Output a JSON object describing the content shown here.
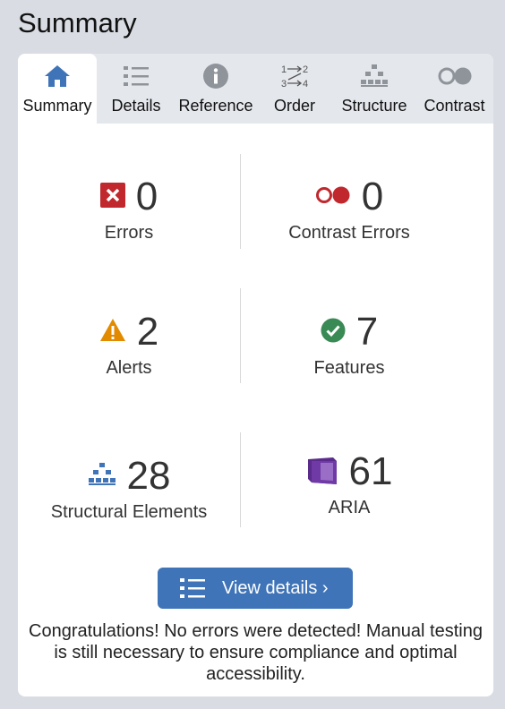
{
  "page_title": "Summary",
  "tabs": [
    {
      "label": "Summary",
      "icon": "home-icon",
      "active": true
    },
    {
      "label": "Details",
      "icon": "list-icon",
      "active": false
    },
    {
      "label": "Reference",
      "icon": "info-icon",
      "active": false
    },
    {
      "label": "Order",
      "icon": "order-icon",
      "active": false
    },
    {
      "label": "Structure",
      "icon": "structure-icon",
      "active": false
    },
    {
      "label": "Contrast",
      "icon": "contrast-icon",
      "active": false
    }
  ],
  "stats": {
    "errors": {
      "value": "0",
      "label": "Errors",
      "color": "#c0282d"
    },
    "contrast_errors": {
      "value": "0",
      "label": "Contrast Errors",
      "color": "#c0282d"
    },
    "alerts": {
      "value": "2",
      "label": "Alerts",
      "color": "#e28a00"
    },
    "features": {
      "value": "7",
      "label": "Features",
      "color": "#3a8a55"
    },
    "structural": {
      "value": "28",
      "label": "Structural Elements",
      "color": "#3f74b8"
    },
    "aria": {
      "value": "61",
      "label": "ARIA",
      "color": "#5b2b8c"
    }
  },
  "view_button": {
    "label": "View details ›"
  },
  "message": "Congratulations! No errors were detected! Manual testing is still necessary to ensure compliance and optimal accessibility.",
  "colors": {
    "accent": "#3f74b8",
    "background": "#d9dde3",
    "tab_bar": "#e4e7ec"
  }
}
